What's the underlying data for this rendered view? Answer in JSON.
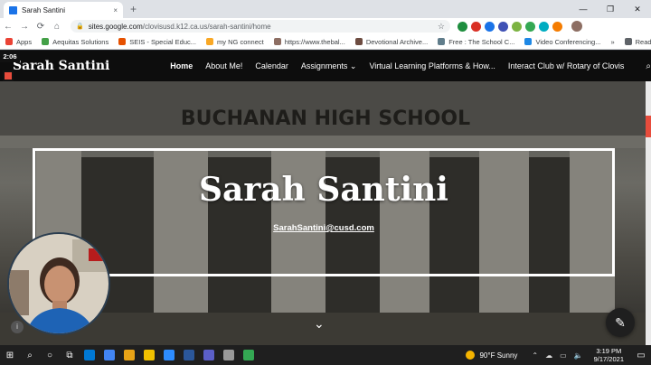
{
  "browser": {
    "tab_title": "Sarah Santini",
    "tab_close": "×",
    "new_tab": "+",
    "window_controls": [
      "—",
      "❐",
      "✕"
    ],
    "url_domain": "sites.google.com",
    "url_path": "/clovisusd.k12.ca.us/sarah-santini/home",
    "lock_icon": "🔒",
    "star_icon": "☆",
    "nav": {
      "back": "←",
      "forward": "→",
      "reload": "⟳",
      "home": "⌂"
    },
    "extension_colors": [
      "#1e8e3e",
      "#d93025",
      "#1a73e8",
      "#3f51b5",
      "#7cb342",
      "#34a853",
      "#00acc1",
      "#f57c00"
    ]
  },
  "bookmarks": {
    "items": [
      {
        "label": "Apps",
        "color": "#ea4335"
      },
      {
        "label": "Aequitas Solutions",
        "color": "#43a047"
      },
      {
        "label": "SEIS - Special Educ...",
        "color": "#e65100"
      },
      {
        "label": "my NG connect",
        "color": "#f9a825"
      },
      {
        "label": "https://www.thebal...",
        "color": "#8d6e63"
      },
      {
        "label": "Devotional Archive...",
        "color": "#6d4c41"
      },
      {
        "label": "Free : The School C...",
        "color": "#607d8b"
      },
      {
        "label": "Video Conferencing...",
        "color": "#1e88e5"
      }
    ],
    "more": "»",
    "reading_list": "Reading list"
  },
  "site": {
    "name": "Sarah Santini",
    "nav": [
      {
        "label": "Home",
        "active": true
      },
      {
        "label": "About Me!",
        "active": false
      },
      {
        "label": "Calendar",
        "active": false
      },
      {
        "label": "Assignments ⌄",
        "active": false
      },
      {
        "label": "Virtual Learning Platforms & How...",
        "active": false
      },
      {
        "label": "Interact Club w/ Rotary of Clovis",
        "active": false
      }
    ],
    "search_icon": "⌕",
    "hero_title": "Sarah Santini",
    "hero_email": "SarahSantini@cusd.com",
    "scroll_chevron": "⌄",
    "building_sign": "BUCHANAN HIGH SCHOOL",
    "edit_icon": "✎",
    "info_icon": "i"
  },
  "recorder": {
    "time": "2:06"
  },
  "taskbar": {
    "start": "⊞",
    "search": "⌕",
    "cortana": "○",
    "taskview": "⧉",
    "weather_temp": "90°F",
    "weather_desc": "Sunny",
    "tray_up": "⌃",
    "time": "3:19 PM",
    "date": "9/17/2021",
    "notification": "▭",
    "app_colors": [
      "#0078d4",
      "#4285f4",
      "#e8a317",
      "#f0c000",
      "#2d8cff",
      "#2b579a",
      "#5b5fc7",
      "#999999",
      "#34a853"
    ]
  }
}
